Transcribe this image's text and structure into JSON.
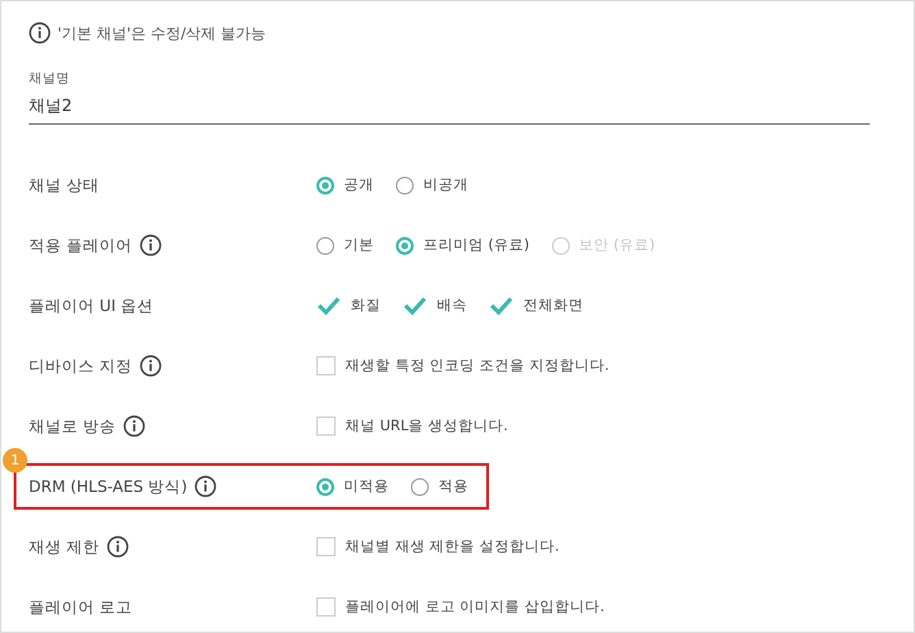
{
  "notice": "'기본 채널'은 수정/삭제 불가능",
  "name_field": {
    "label": "채널명",
    "value": "채널2"
  },
  "rows": [
    {
      "label": "채널 상태",
      "info": false,
      "kind": "radio",
      "options": [
        {
          "label": "공개",
          "selected": true,
          "disabled": false
        },
        {
          "label": "비공개",
          "selected": false,
          "disabled": false
        }
      ]
    },
    {
      "label": "적용 플레이어",
      "info": true,
      "kind": "radio",
      "options": [
        {
          "label": "기본",
          "selected": false,
          "disabled": false
        },
        {
          "label": "프리미엄 (유료)",
          "selected": true,
          "disabled": false
        },
        {
          "label": "보안 (유료)",
          "selected": false,
          "disabled": true
        }
      ]
    },
    {
      "label": "플레이어 UI 옵션",
      "info": false,
      "kind": "check",
      "options": [
        {
          "label": "화질",
          "checked": true
        },
        {
          "label": "배속",
          "checked": true
        },
        {
          "label": "전체화면",
          "checked": true
        }
      ]
    },
    {
      "label": "디바이스 지정",
      "info": true,
      "kind": "checkbox",
      "options": [
        {
          "label": "재생할 특정 인코딩 조건을 지정합니다.",
          "checked": false
        }
      ]
    },
    {
      "label": "채널로 방송",
      "info": true,
      "kind": "checkbox",
      "options": [
        {
          "label": "채널 URL을 생성합니다.",
          "checked": false
        }
      ]
    },
    {
      "label": "DRM (HLS-AES 방식)",
      "info": true,
      "kind": "radio",
      "highlight": "1",
      "options": [
        {
          "label": "미적용",
          "selected": true,
          "disabled": false
        },
        {
          "label": "적용",
          "selected": false,
          "disabled": false
        }
      ]
    },
    {
      "label": "재생 제한",
      "info": true,
      "kind": "checkbox",
      "options": [
        {
          "label": "채널별 재생 제한을 설정합니다.",
          "checked": false
        }
      ]
    },
    {
      "label": "플레이어 로고",
      "info": false,
      "kind": "checkbox",
      "options": [
        {
          "label": "플레이어에 로고 이미지를 삽입합니다.",
          "checked": false
        }
      ]
    }
  ]
}
